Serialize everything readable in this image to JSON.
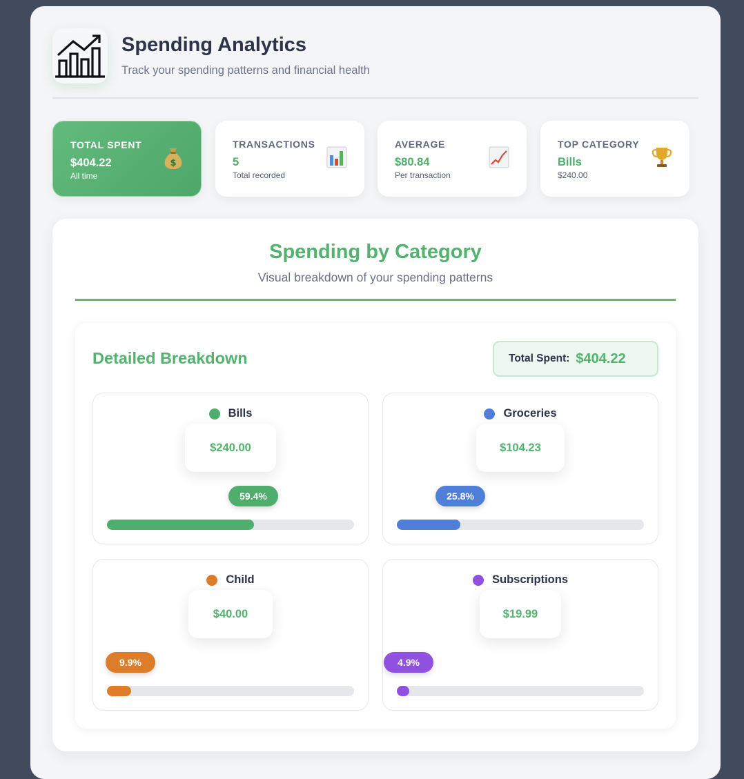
{
  "header": {
    "title": "Spending Analytics",
    "subtitle": "Track your spending patterns and financial health",
    "logo_icon": "line-chart-icon"
  },
  "stats": [
    {
      "label": "TOTAL SPENT",
      "value": "$404.22",
      "caption": "All time",
      "icon": "money-bag-icon"
    },
    {
      "label": "TRANSACTIONS",
      "value": "5",
      "caption": "Total recorded",
      "icon": "bar-chart-icon"
    },
    {
      "label": "AVERAGE",
      "value": "$80.84",
      "caption": "Per transaction",
      "icon": "trending-up-icon"
    },
    {
      "label": "TOP CATEGORY",
      "value": "Bills",
      "caption": "$240.00",
      "icon": "trophy-icon"
    }
  ],
  "panel": {
    "title": "Spending by Category",
    "subtitle": "Visual breakdown of your spending patterns"
  },
  "breakdown": {
    "title": "Detailed Breakdown",
    "total_label": "Total Spent:",
    "total_value": "$404.22",
    "categories": [
      {
        "name": "Bills",
        "amount": "$240.00",
        "percent_label": "59.4%",
        "percent": 59.4,
        "color": "#4fae6c"
      },
      {
        "name": "Groceries",
        "amount": "$104.23",
        "percent_label": "25.8%",
        "percent": 25.8,
        "color": "#4f7fd8"
      },
      {
        "name": "Child",
        "amount": "$40.00",
        "percent_label": "9.9%",
        "percent": 9.9,
        "color": "#dd7d2a"
      },
      {
        "name": "Subscriptions",
        "amount": "$19.99",
        "percent_label": "4.9%",
        "percent": 4.9,
        "color": "#9050e0"
      }
    ]
  }
}
